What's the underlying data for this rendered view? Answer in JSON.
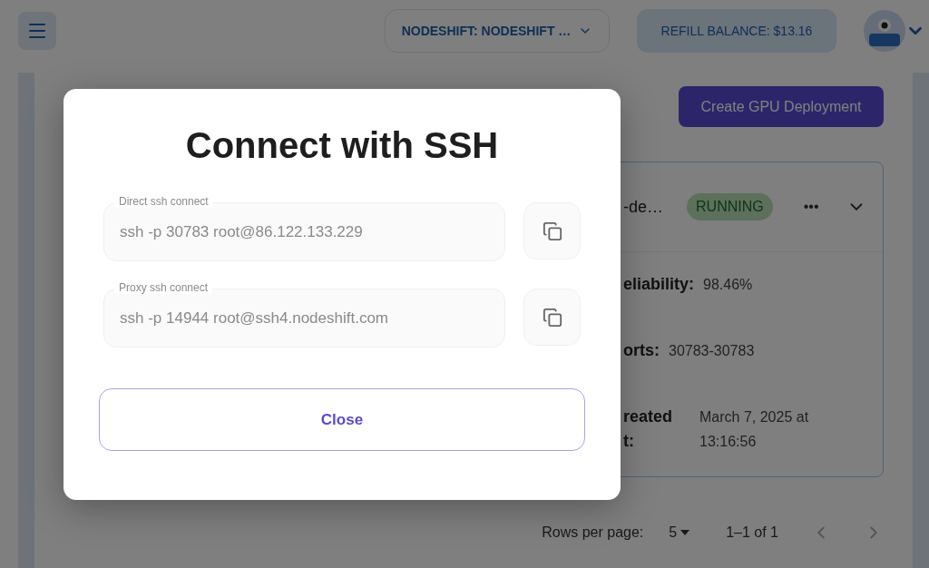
{
  "header": {
    "organization": "NODESHIFT: NODESHIFT …",
    "refill_label": "REFILL BALANCE:",
    "balance": "$13.16"
  },
  "create_button": "Create GPU Deployment",
  "deployment": {
    "name": "-de…",
    "status": "RUNNING",
    "more": "•••",
    "details": [
      {
        "label": "eliability:",
        "value": "98.46%"
      },
      {
        "label": "orts:",
        "value": "30783-30783"
      },
      {
        "label": "reated\nt:",
        "value": "March 7, 2025 at 13:16:56"
      }
    ]
  },
  "pagination": {
    "rows_label": "Rows per page:",
    "rows_value": "5",
    "range": "1–1 of 1"
  },
  "dialog": {
    "title": "Connect with SSH",
    "fields": [
      {
        "label": "Direct ssh connect",
        "value": "ssh -p 30783 root@86.122.133.229"
      },
      {
        "label": "Proxy ssh connect",
        "value": "ssh -p 14944 root@ssh4.nodeshift.com"
      }
    ],
    "close": "Close"
  }
}
